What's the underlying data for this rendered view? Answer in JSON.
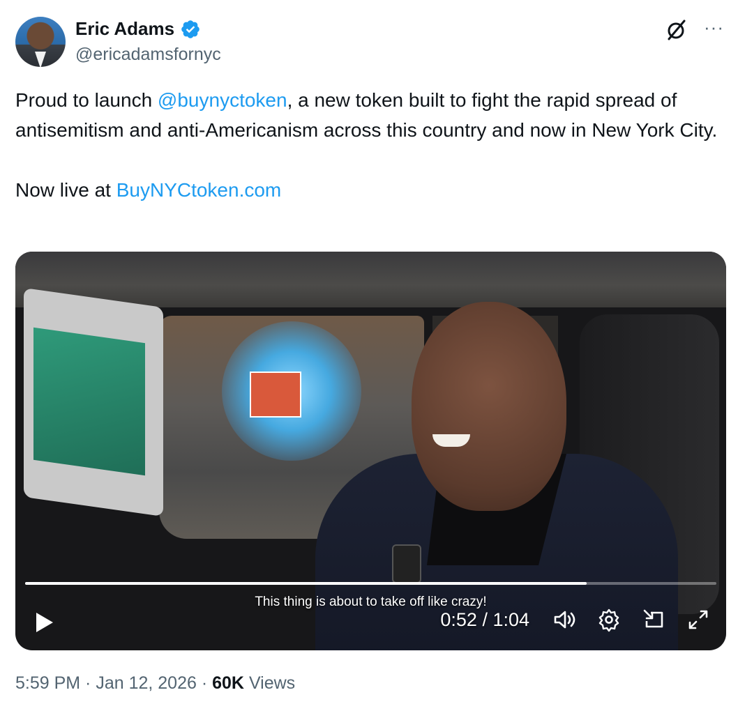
{
  "author": {
    "name": "Eric Adams",
    "handle": "@ericadamsfornyc",
    "verified": true
  },
  "header_icons": {
    "grok": "grok-icon",
    "more": "more-icon",
    "more_glyph": "···"
  },
  "tweet": {
    "line1_pre": "Proud to launch ",
    "mention": "@buynyctoken",
    "line1_post": ", a new token built to fight the rapid spread of antisemitism and anti-Americanism across this country and now in New York City.",
    "live_pre": "Now live at ",
    "live_link": "BuyNYCtoken.com"
  },
  "video": {
    "caption": "This thing is about to take off like crazy!",
    "time_display": "0:52 / 1:04",
    "progress": 0.8125,
    "controls": [
      "play-icon",
      "volume-icon",
      "settings-icon",
      "pip-icon",
      "fullscreen-icon"
    ]
  },
  "meta": {
    "time": "5:59 PM",
    "sep1": " · ",
    "date": "Jan 12, 2026",
    "sep2": " · ",
    "views_count": "60K",
    "views_label": " Views"
  },
  "colors": {
    "link": "#1d9bf0",
    "secondary_text": "#536471",
    "primary_text": "#0f1419",
    "verified_badge": "#1d9bf0"
  }
}
